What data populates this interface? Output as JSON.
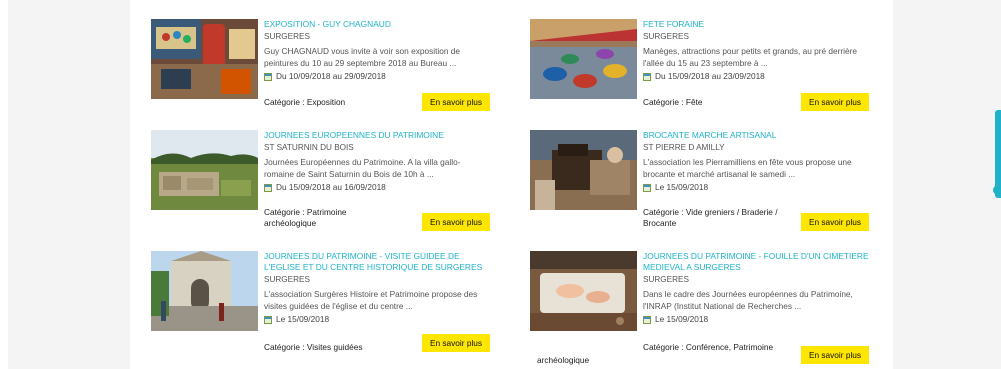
{
  "events": [
    {
      "title": "EXPOSITION - GUY CHAGNAUD",
      "town": "SURGERES",
      "desc": "Guy CHAGNAUD vous invite à voir son exposition de peintures du 10 au 29 septembre 2018 au Bureau ...",
      "date": "Du 10/09/2018 au 29/09/2018",
      "category": "Catégorie : Exposition",
      "more": "En savoir plus"
    },
    {
      "title": "FETE FORAINE",
      "town": "SURGERES",
      "desc": "Manèges, attractions pour petits et grands, au pré derrière l'allée du 15 au 23 septembre à ...",
      "date": "Du 15/09/2018 au 23/09/2018",
      "category": "Catégorie : Fête",
      "more": "En savoir plus"
    },
    {
      "title": "JOURNEES EUROPEENNES DU PATRIMOINE",
      "town": "ST SATURNIN DU BOIS",
      "desc": "Journées Européennes du Patrimoine. A la villa gallo-romaine de Saint Saturnin du Bois de 10h à ...",
      "date": "Du 15/09/2018 au 16/09/2018",
      "category": "Catégorie : Patrimoine archéologique",
      "more": "En savoir plus"
    },
    {
      "title": "BROCANTE MARCHE ARTISANAL",
      "town": "ST PIERRE D AMILLY",
      "desc": "L'association les Pierramilliens en fête vous propose une brocante et marché artisanal le samedi ...",
      "date": "Le 15/09/2018",
      "category": "Catégorie : Vide greniers / Braderie / Brocante",
      "more": "En savoir plus"
    },
    {
      "title": "JOURNEES DU PATRIMOINE - VISITE GUIDEE DE L'EGLISE ET DU CENTRE HISTORIQUE DE SURGERES",
      "town": "SURGERES",
      "desc": "L'association Surgères Histoire et Patrimoine propose des visites guidées de l'église et du centre ...",
      "date": "Le 15/09/2018",
      "category": "Catégorie : Visites guidées",
      "more": "En savoir plus"
    },
    {
      "title": "JOURNEES DU PATRIMOINE - FOUILLE D'UN CIMETIERE MEDIEVAL A SURGERES",
      "town": "SURGERES",
      "desc": "Dans le cadre des Journées européennes du Patrimoine, l'INRAP (Institut National de Recherches ...",
      "date": "Le 15/09/2018",
      "category": "Catégorie : Conférence, Patrimoine",
      "category_overflow": "archéologique",
      "more": "En savoir plus"
    }
  ]
}
